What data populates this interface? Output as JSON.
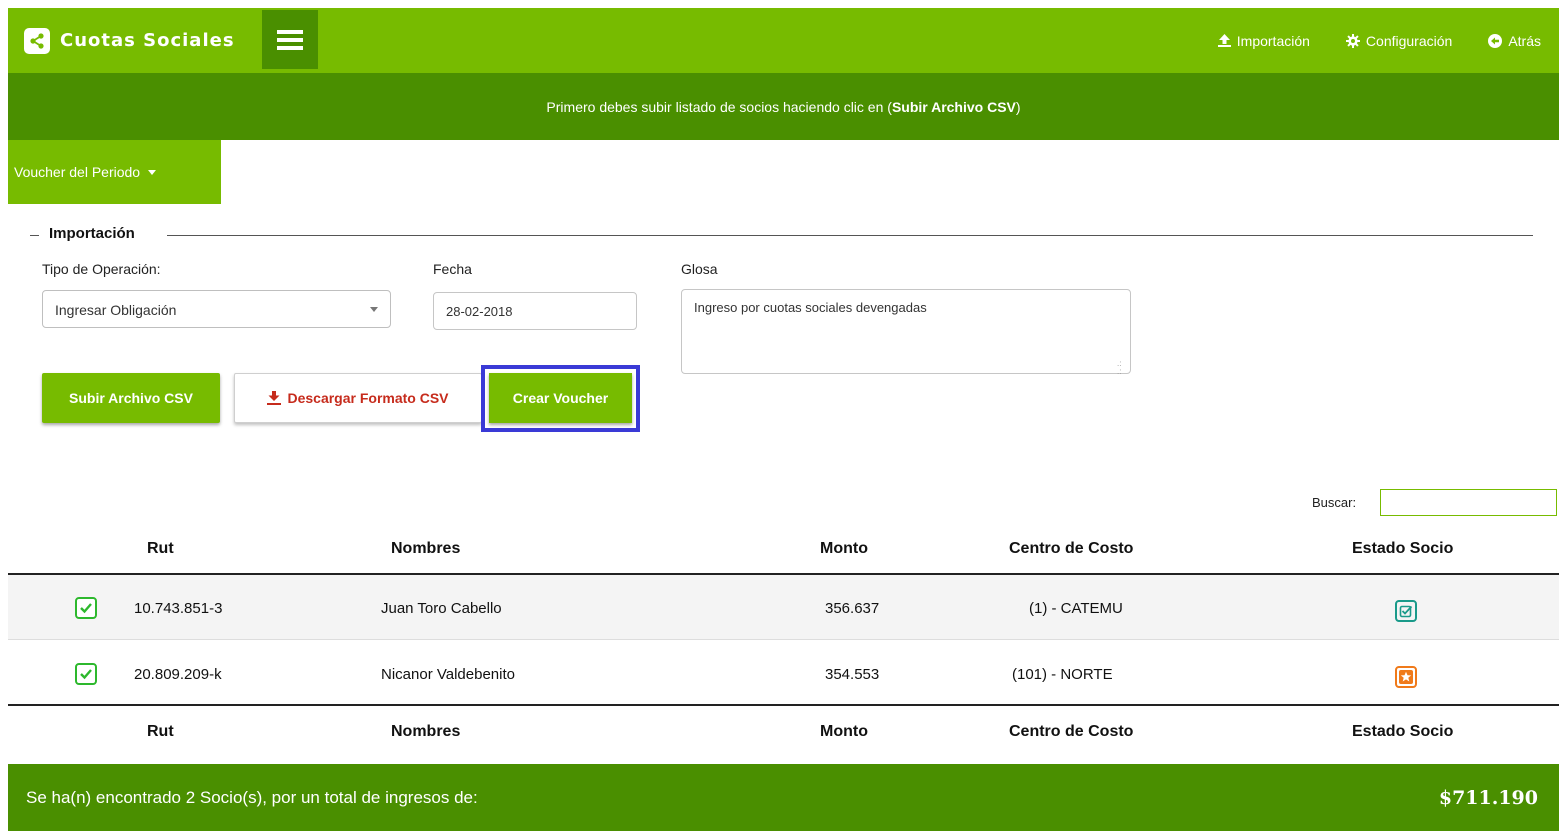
{
  "header": {
    "app_title": "Cuotas Sociales",
    "nav": {
      "import_label": "Importación",
      "config_label": "Configuración",
      "back_label": "Atrás"
    }
  },
  "notice": {
    "text": "Primero debes subir listado de socios haciendo clic en (",
    "bold": "Subir Archivo CSV",
    "end": ")"
  },
  "period_dropdown": {
    "label": "Voucher del Periodo"
  },
  "form": {
    "legend": "Importación",
    "operation_label": "Tipo de Operación:",
    "operation_value": "Ingresar Obligación",
    "date_label": "Fecha",
    "date_value": "28-02-2018",
    "glosa_label": "Glosa",
    "glosa_value": "Ingreso por cuotas sociales devengadas"
  },
  "buttons": {
    "upload": "Subir Archivo CSV",
    "download": "Descargar Formato CSV",
    "create": "Crear Voucher"
  },
  "search": {
    "label": "Buscar:",
    "value": ""
  },
  "table": {
    "headers": [
      "Rut",
      "Nombres",
      "Monto",
      "Centro de Costo",
      "Estado Socio"
    ],
    "rows": [
      {
        "checked": true,
        "rut": "10.743.851-3",
        "nombre": "Juan Toro Cabello",
        "monto": "356.637",
        "centro": "(1) - CATEMU",
        "estado_icon": "check-square-icon",
        "estado_color": "#1a9a8a"
      },
      {
        "checked": true,
        "rut": "20.809.209-k",
        "nombre": "Nicanor Valdebenito",
        "monto": "354.553",
        "centro": "(101) - NORTE",
        "estado_icon": "star-icon",
        "estado_color": "#f07a1a"
      }
    ]
  },
  "footer": {
    "summary": "Se ha(n) encontrado 2 Socio(s), por un total de ingresos de:",
    "total": "$711.190"
  },
  "colors": {
    "primary_green": "#77bb00",
    "dark_green": "#4a8f00",
    "download_red": "#c62b1c",
    "highlight_blue": "#3a3ad6"
  }
}
